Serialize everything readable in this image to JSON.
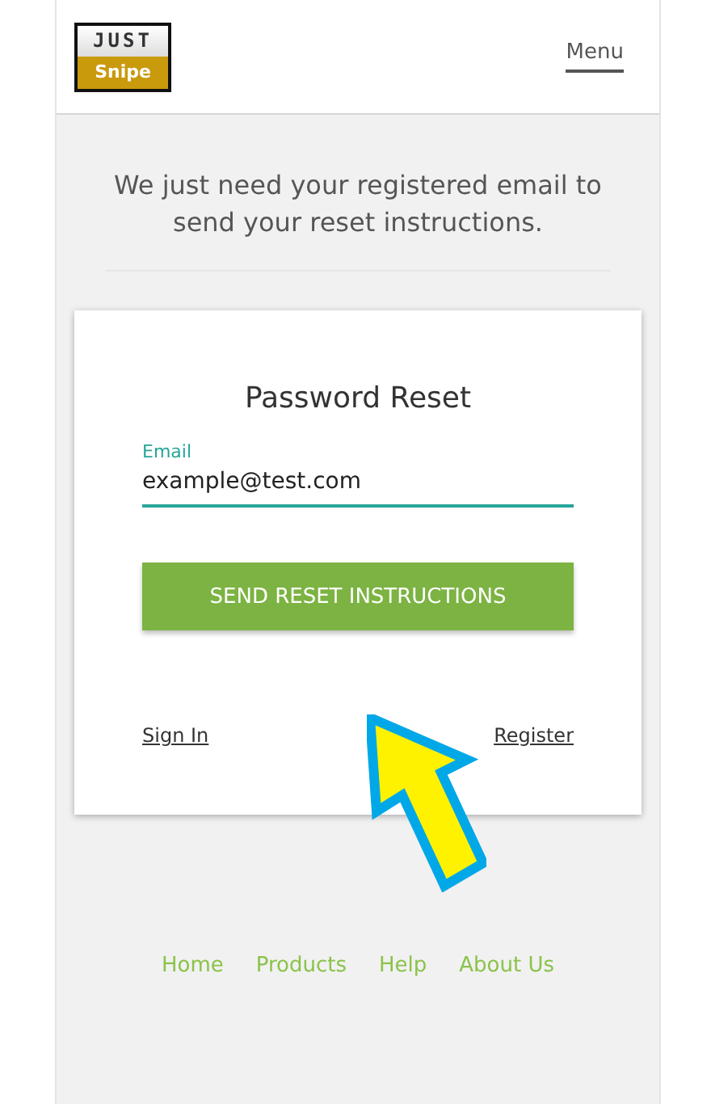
{
  "header": {
    "logo": {
      "top": "JUST",
      "bottom": "Snipe"
    },
    "menu": "Menu"
  },
  "intro": "We just need your registered email to send your reset instructions.",
  "card": {
    "title": "Password Reset",
    "email": {
      "label": "Email",
      "value": "example@test.com"
    },
    "submit": "SEND RESET INSTRUCTIONS",
    "links": [
      "Sign In",
      "Register"
    ]
  },
  "footer": {
    "links": [
      "Home",
      "Products",
      "Help",
      "About Us"
    ]
  }
}
